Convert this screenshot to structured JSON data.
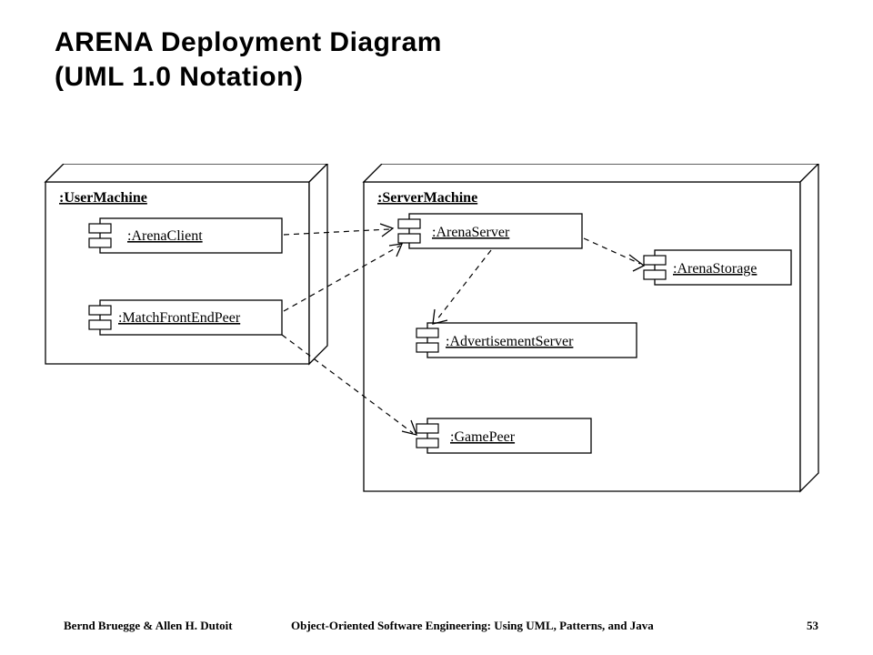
{
  "title_line1": "ARENA Deployment Diagram",
  "title_line2": "(UML 1.0 Notation)",
  "nodes": {
    "user_machine": ":UserMachine",
    "server_machine": ":ServerMachine"
  },
  "components": {
    "arena_client": ":ArenaClient",
    "match_front_end_peer": ":MatchFrontEndPeer",
    "arena_server": ":ArenaServer",
    "advertisement_server": ":AdvertisementServer",
    "game_peer": ":GamePeer",
    "arena_storage": ":ArenaStorage"
  },
  "dependencies": [
    {
      "from": "arena_client",
      "to": "arena_server"
    },
    {
      "from": "match_front_end_peer",
      "to": "arena_server"
    },
    {
      "from": "arena_server",
      "to": "arena_storage"
    },
    {
      "from": "arena_server",
      "to": "advertisement_server"
    },
    {
      "from": "match_front_end_peer",
      "to": "game_peer"
    }
  ],
  "footer": {
    "authors": "Bernd Bruegge & Allen H. Dutoit",
    "book": "Object-Oriented Software Engineering: Using UML, Patterns, and Java",
    "page": "53"
  }
}
